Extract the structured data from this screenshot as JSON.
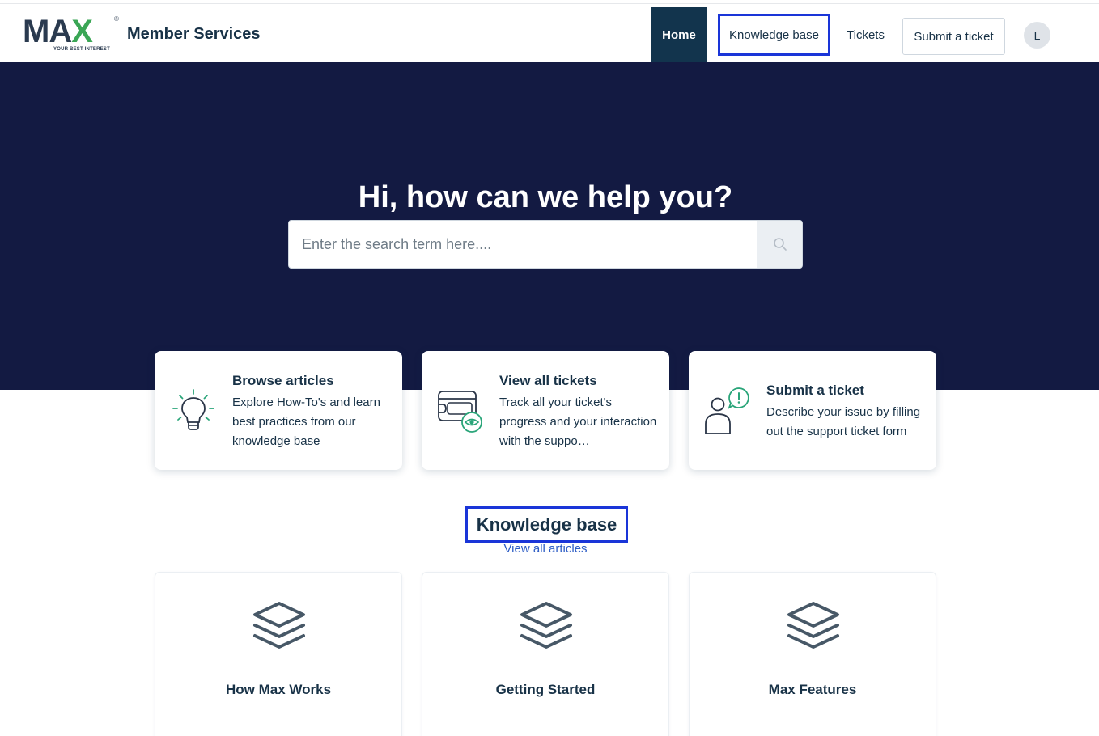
{
  "header": {
    "logo": {
      "text": "MAX",
      "tagline": "YOUR BEST INTEREST",
      "registered": "®"
    },
    "brand_title": "Member Services",
    "nav": {
      "home": "Home",
      "knowledge_base": "Knowledge base",
      "tickets": "Tickets",
      "submit_ticket": "Submit a ticket"
    },
    "avatar_initial": "L"
  },
  "hero": {
    "title": "Hi, how can we help you?",
    "search": {
      "placeholder": "Enter the search term here....",
      "value": "",
      "icon": "search-icon"
    }
  },
  "action_cards": [
    {
      "title": "Browse articles",
      "description": "Explore How-To's and learn best practices from our knowledge base",
      "icon": "lightbulb-icon"
    },
    {
      "title": "View all tickets",
      "description": "Track all your ticket's progress and your interaction with the suppo…",
      "icon": "tickets-eye-icon"
    },
    {
      "title": "Submit a ticket",
      "description": "Describe your issue by filling out the support ticket form",
      "icon": "person-alert-icon"
    }
  ],
  "knowledge_base": {
    "heading": "Knowledge base",
    "view_all": "View all articles",
    "categories": [
      {
        "title": "How Max Works",
        "icon": "layers-icon"
      },
      {
        "title": "Getting Started",
        "icon": "layers-icon"
      },
      {
        "title": "Max Features",
        "icon": "layers-icon"
      }
    ]
  },
  "colors": {
    "hero_bg": "#131a42",
    "nav_active_bg": "#12344d",
    "text_primary": "#183247",
    "link": "#2c5cc5",
    "highlight_border": "#1a35d8",
    "icon_accent": "#2aa579",
    "logo_green": "#3aa655"
  }
}
